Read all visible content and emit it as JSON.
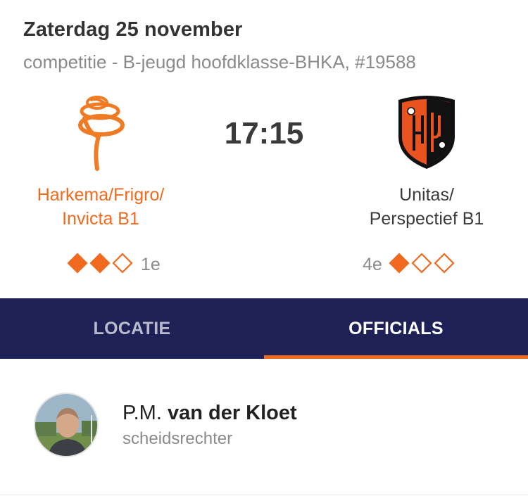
{
  "match": {
    "date": "Zaterdag 25 november",
    "competition": "competitie - B-jeugd hoofdklasse-BHKA, #19588",
    "kickoff": "17:15"
  },
  "home": {
    "name_line1": "Harkema/Frigro/",
    "name_line2": "Invicta B1",
    "rank": "1e",
    "rating": 2,
    "rating_max": 3,
    "logo_icon": "harkema-frigro-club-logo"
  },
  "away": {
    "name_line1": "Unitas/",
    "name_line2": "Perspectief B1",
    "rank": "4e",
    "rating": 1,
    "rating_max": 3,
    "logo_icon": "unitas-perspectief-club-crest"
  },
  "tabs": [
    {
      "label": "LOCATIE",
      "active": false
    },
    {
      "label": "OFFICIALS",
      "active": true
    }
  ],
  "officials": [
    {
      "initials": "P.M.",
      "surname": "van der Kloet",
      "role": "scheidsrechter",
      "avatar_icon": "referee-photo"
    }
  ],
  "colors": {
    "accent": "#ef6a1f",
    "tabbar": "#1d2156",
    "text_muted": "#8a8a8a"
  }
}
